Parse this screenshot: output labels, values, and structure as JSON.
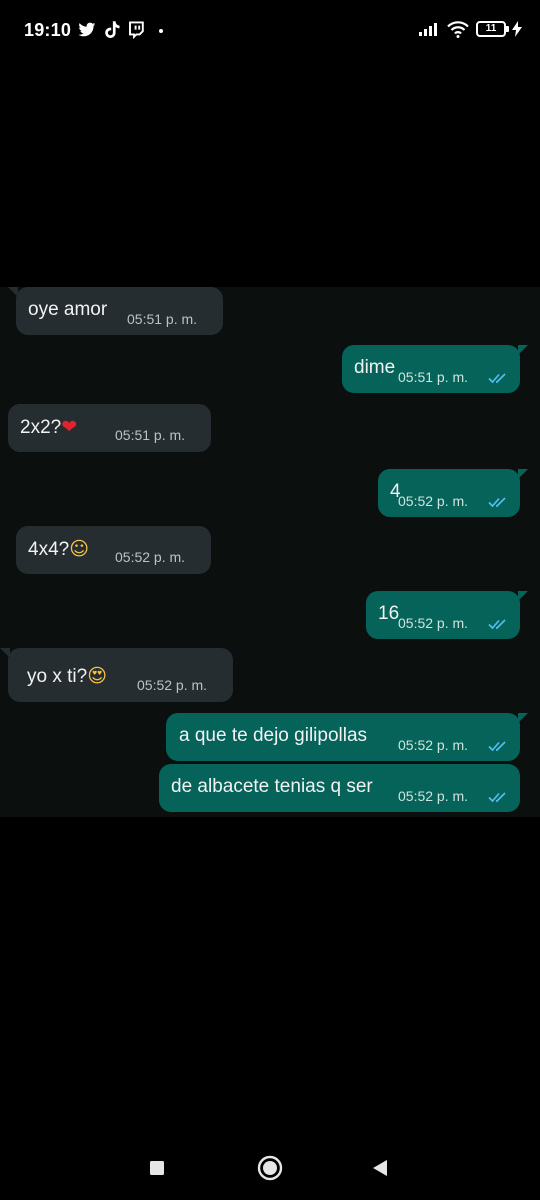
{
  "status_bar": {
    "time": "19:10",
    "left_icons": [
      "twitter-icon",
      "tiktok-icon",
      "twitch-icon"
    ],
    "battery": "11"
  },
  "messages": [
    {
      "dir": "in",
      "text": "oye amor",
      "emoji": "",
      "time": "05:51 p. m."
    },
    {
      "dir": "out",
      "text": "dime",
      "emoji": "",
      "time": "05:51 p. m.",
      "status": "read"
    },
    {
      "dir": "in",
      "text": "2x2?",
      "emoji": "❤",
      "time": "05:51 p. m."
    },
    {
      "dir": "out",
      "text": "4",
      "emoji": "",
      "time": "05:52 p. m.",
      "status": "read"
    },
    {
      "dir": "in",
      "text": "4x4?",
      "emoji": "☺",
      "time": "05:52 p. m."
    },
    {
      "dir": "out",
      "text": "16",
      "emoji": "",
      "time": "05:52 p. m.",
      "status": "read"
    },
    {
      "dir": "in",
      "text": "yo x ti?",
      "emoji": "😍",
      "time": "05:52 p. m."
    },
    {
      "dir": "out",
      "text": "a que te dejo gilipollas",
      "emoji": "",
      "time": "05:52 p. m.",
      "status": "read"
    },
    {
      "dir": "out",
      "text": "de albacete tenias q ser",
      "emoji": "",
      "time": "05:52 p. m.",
      "status": "read"
    }
  ],
  "colors": {
    "incoming_bubble": "#252d31",
    "outgoing_bubble": "#05635a",
    "read_ticks": "#53bdeb"
  },
  "nav_bar": [
    "recents-button",
    "home-button",
    "back-button"
  ]
}
